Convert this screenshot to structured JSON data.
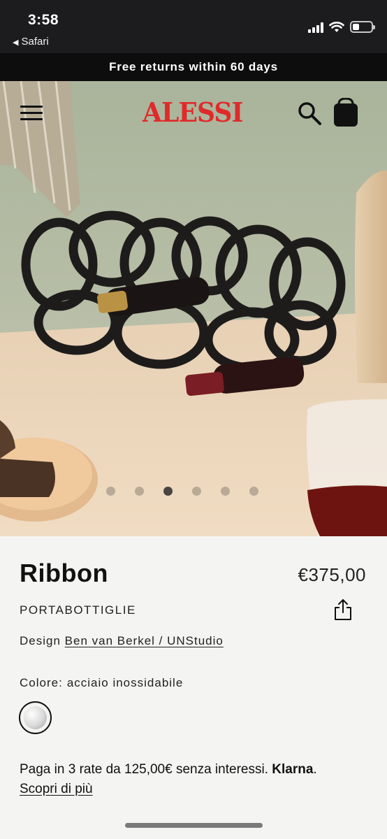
{
  "status_bar": {
    "time": "3:58",
    "back_app": "Safari"
  },
  "promo": {
    "text": "Free returns within 60 days"
  },
  "header": {
    "logo": "ALESSI",
    "icons": [
      "menu-icon",
      "search-icon",
      "bag-icon"
    ]
  },
  "carousel": {
    "slide_count": 6,
    "active_index": 2
  },
  "product": {
    "name": "Ribbon",
    "price": "€375,00",
    "category": "PORTABOTTIGLIE",
    "design_label": "Design",
    "designer": "Ben van Berkel / UNStudio",
    "color_label": "Colore:",
    "color_value": "acciaio inossidabile"
  },
  "klarna": {
    "text": "Paga in 3 rate da 125,00€ senza interessi.",
    "brand": "Klarna",
    "brand_suffix": ".",
    "link": "Scopri di più"
  },
  "colors": {
    "brand_red": "#e02a2a",
    "promo_bg": "#0d0d0d"
  }
}
